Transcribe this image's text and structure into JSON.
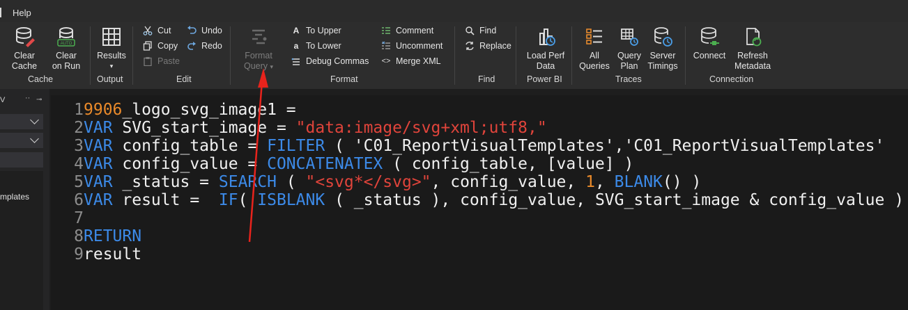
{
  "menu": {
    "help": "Help"
  },
  "ribbon": {
    "cache": {
      "clear_cache": [
        "Clear",
        "Cache"
      ],
      "clear_on_run": [
        "Clear",
        "on Run"
      ],
      "auto_badge": "AUTO",
      "label": "Cache"
    },
    "output": {
      "results": "Results",
      "label": "Output"
    },
    "edit": {
      "cut": "Cut",
      "copy": "Copy",
      "paste": "Paste",
      "undo": "Undo",
      "redo": "Redo",
      "label": "Edit"
    },
    "format": {
      "format_query": [
        "Format",
        "Query"
      ],
      "to_upper": "To Upper",
      "to_lower": "To Lower",
      "debug_commas": "Debug Commas",
      "comment": "Comment",
      "uncomment": "Uncomment",
      "merge_xml": "Merge XML",
      "label": "Format"
    },
    "find": {
      "find": "Find",
      "replace": "Replace",
      "label": "Find"
    },
    "powerbi": {
      "load_perf": [
        "Load Perf",
        "Data"
      ],
      "label": "Power BI"
    },
    "traces": {
      "all_queries": [
        "All",
        "Queries"
      ],
      "query_plan": [
        "Query",
        "Plan"
      ],
      "server_timings": [
        "Server",
        "Timings"
      ],
      "label": "Traces"
    },
    "connection": {
      "connect": "Connect",
      "refresh_metadata": [
        "Refresh",
        "Metadata"
      ],
      "label": "Connection"
    }
  },
  "left_panel": {
    "title": "V",
    "dots": "··",
    "pin": "📌",
    "item": "mplates"
  },
  "editor": {
    "lines": [
      {
        "n": "1",
        "tokens": [
          {
            "t": "num",
            "v": "9906"
          },
          {
            "t": "code",
            "v": "_logo_svg_image1 ="
          }
        ]
      },
      {
        "n": "2",
        "tokens": [
          {
            "t": "kw",
            "v": "VAR"
          },
          {
            "t": "code",
            "v": " SVG_start_image = "
          },
          {
            "t": "str",
            "v": "\"data:image/svg+xml;utf8,\""
          }
        ]
      },
      {
        "n": "3",
        "tokens": [
          {
            "t": "kw",
            "v": "VAR"
          },
          {
            "t": "code",
            "v": " config_table = "
          },
          {
            "t": "kw",
            "v": "FILTER"
          },
          {
            "t": "code",
            "v": " ( 'C01_ReportVisualTemplates','C01_ReportVisualTemplates'"
          }
        ]
      },
      {
        "n": "4",
        "tokens": [
          {
            "t": "kw",
            "v": "VAR"
          },
          {
            "t": "code",
            "v": " config_value = "
          },
          {
            "t": "kw",
            "v": "CONCATENATEX"
          },
          {
            "t": "code",
            "v": " ( config_table, [value] )"
          }
        ]
      },
      {
        "n": "5",
        "tokens": [
          {
            "t": "kw",
            "v": "VAR"
          },
          {
            "t": "code",
            "v": " _status = "
          },
          {
            "t": "kw",
            "v": "SEARCH"
          },
          {
            "t": "code",
            "v": " ( "
          },
          {
            "t": "str",
            "v": "\"<svg*</svg>\""
          },
          {
            "t": "code",
            "v": ", config_value, "
          },
          {
            "t": "num",
            "v": "1"
          },
          {
            "t": "code",
            "v": ", "
          },
          {
            "t": "kw",
            "v": "BLANK"
          },
          {
            "t": "code",
            "v": "() )"
          }
        ]
      },
      {
        "n": "6",
        "tokens": [
          {
            "t": "kw",
            "v": "VAR"
          },
          {
            "t": "code",
            "v": " result =  "
          },
          {
            "t": "kw",
            "v": "IF"
          },
          {
            "t": "code",
            "v": "( "
          },
          {
            "t": "kw",
            "v": "ISBLANK"
          },
          {
            "t": "code",
            "v": " ( _status ), config_value, SVG_start_image & config_value )"
          }
        ]
      },
      {
        "n": "7",
        "tokens": []
      },
      {
        "n": "8",
        "tokens": [
          {
            "t": "kw",
            "v": "RETURN"
          }
        ]
      },
      {
        "n": "9",
        "tokens": [
          {
            "t": "code",
            "v": "result"
          }
        ]
      }
    ]
  },
  "colors": {
    "keyword": "#3c8ae8",
    "string": "#e0443b",
    "number": "#ea8a2a",
    "annotation": "#e8231c"
  },
  "annotation": {
    "shape": "red-arrow",
    "points_to": "format_query"
  }
}
